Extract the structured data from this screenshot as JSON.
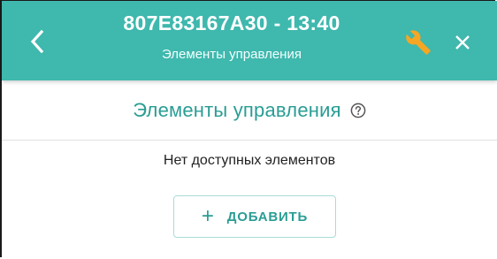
{
  "header": {
    "title": "807E83167A30 - 13:40",
    "subtitle": "Элементы управления",
    "background_color": "#3fb8ae",
    "back_icon": "chevron-left-icon",
    "wrench_icon": "wrench-icon",
    "wrench_color": "#f5a623",
    "close_icon": "close-icon"
  },
  "section": {
    "title": "Элементы управления",
    "help_icon": "help-circle-icon",
    "accent_color": "#2a9d94"
  },
  "content": {
    "empty_message": "Нет доступных элементов"
  },
  "add_button": {
    "icon": "+",
    "label": "ДОБАВИТЬ"
  }
}
